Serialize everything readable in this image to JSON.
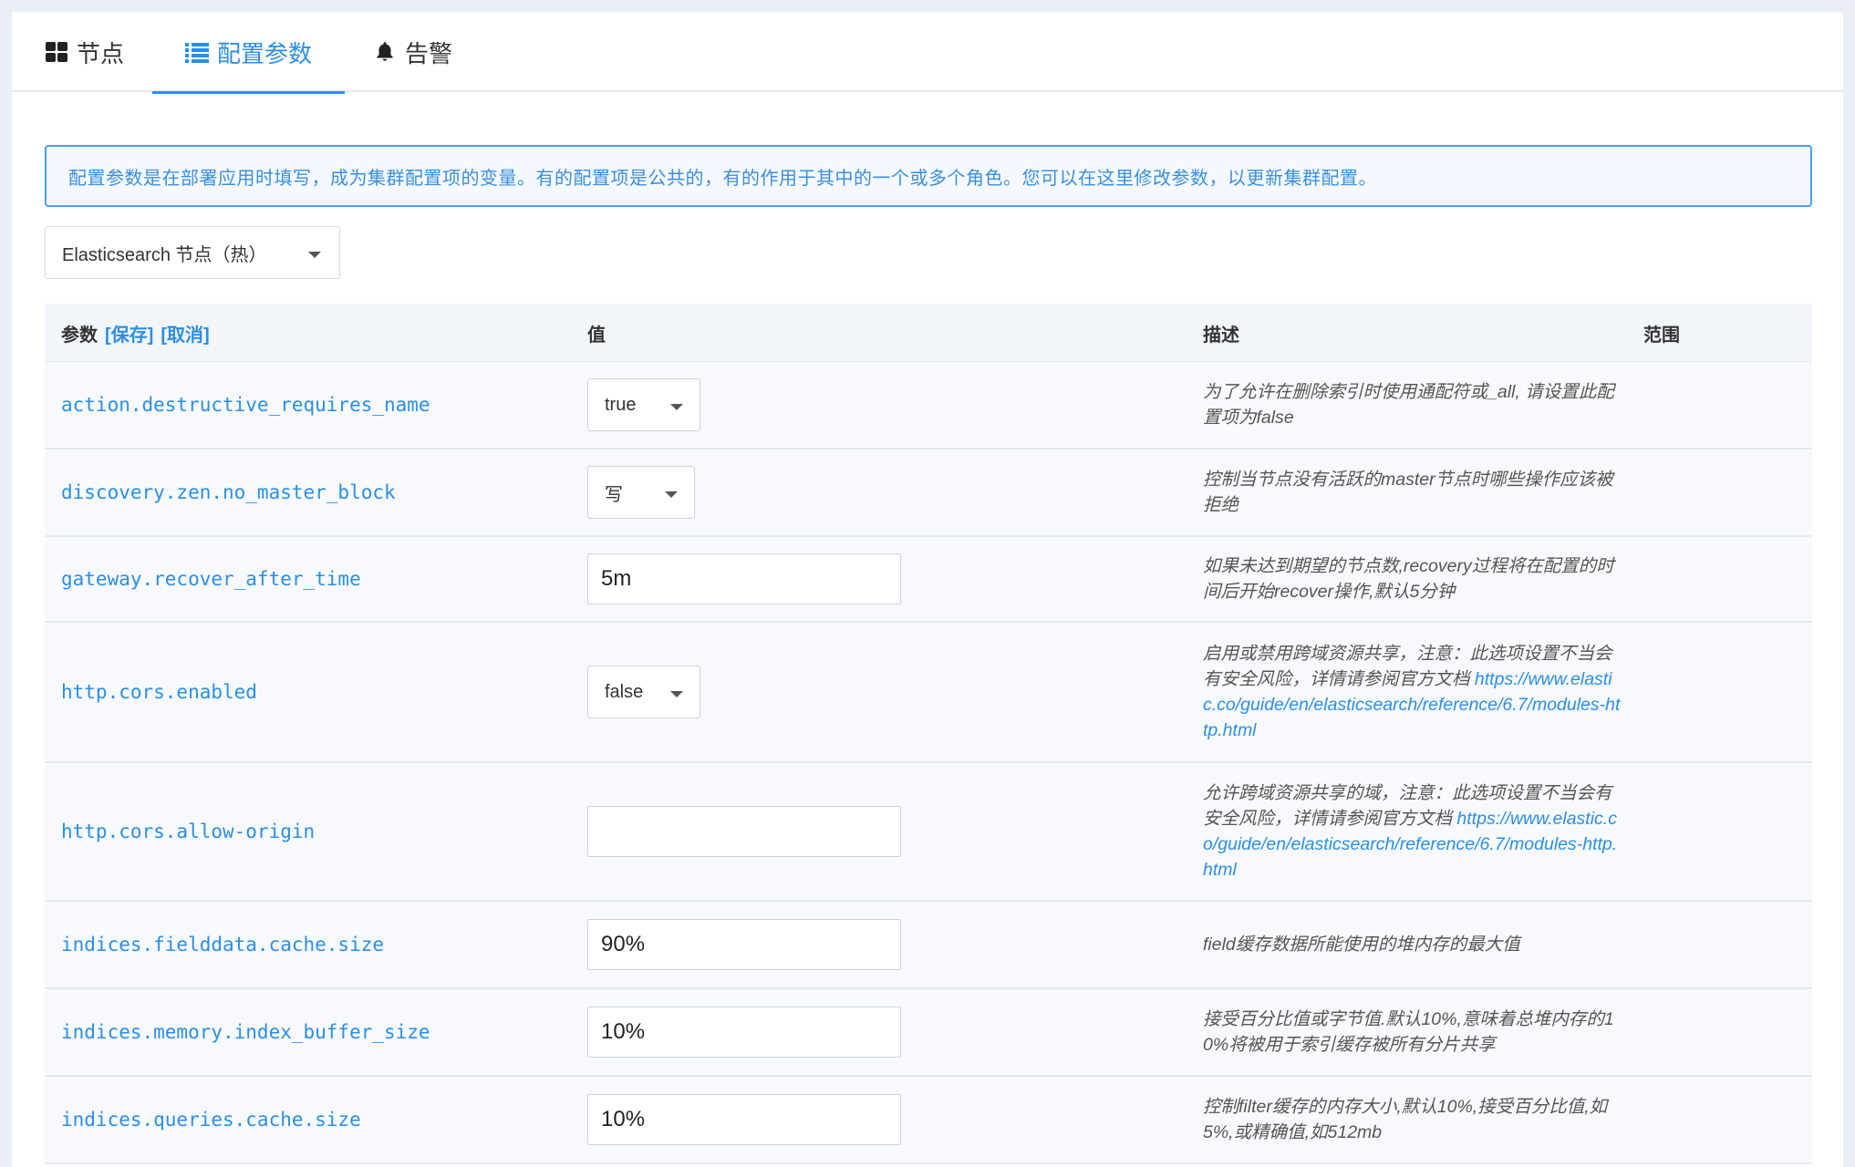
{
  "tabs": [
    {
      "label": "节点",
      "icon": "grid-icon",
      "active": false
    },
    {
      "label": "配置参数",
      "icon": "list-icon",
      "active": true
    },
    {
      "label": "告警",
      "icon": "bell-icon",
      "active": false
    }
  ],
  "info": "配置参数是在部署应用时填写，成为集群配置项的变量。有的配置项是公共的，有的作用于其中的一个或多个角色。您可以在这里修改参数，以更新集群配置。",
  "role_select": {
    "value": "Elasticsearch 节点（热）"
  },
  "table": {
    "headers": {
      "param": "参数",
      "save": "[保存]",
      "cancel": "[取消]",
      "value": "值",
      "desc": "描述",
      "range": "范围"
    },
    "rows": [
      {
        "name": "action.destructive_requires_name",
        "type": "select",
        "value": "true",
        "desc": "为了允许在删除索引时使用通配符或_all, 请设置此配置项为false",
        "link": ""
      },
      {
        "name": "discovery.zen.no_master_block",
        "type": "select",
        "value": "写",
        "desc": "控制当节点没有活跃的master节点时哪些操作应该被拒绝",
        "link": ""
      },
      {
        "name": "gateway.recover_after_time",
        "type": "text",
        "value": "5m",
        "desc": "如果未达到期望的节点数,recovery过程将在配置的时间后开始recover操作,默认5分钟",
        "link": ""
      },
      {
        "name": "http.cors.enabled",
        "type": "select",
        "value": "false",
        "desc": "启用或禁用跨域资源共享，注意：此选项设置不当会有安全风险，详情请参阅官方文档 ",
        "link": "https://www.elastic.co/guide/en/elasticsearch/reference/6.7/modules-http.html"
      },
      {
        "name": "http.cors.allow-origin",
        "type": "text",
        "value": "",
        "desc": "允许跨域资源共享的域，注意：此选项设置不当会有安全风险，详情请参阅官方文档 ",
        "link": "https://www.elastic.co/guide/en/elasticsearch/reference/6.7/modules-http.html"
      },
      {
        "name": "indices.fielddata.cache.size",
        "type": "text",
        "value": "90%",
        "desc": "field缓存数据所能使用的堆内存的最大值",
        "link": ""
      },
      {
        "name": "indices.memory.index_buffer_size",
        "type": "text",
        "value": "10%",
        "desc": "接受百分比值或字节值.默认10%,意味着总堆内存的10%将被用于索引缓存被所有分片共享",
        "link": ""
      },
      {
        "name": "indices.queries.cache.size",
        "type": "text",
        "value": "10%",
        "desc": "控制filter缓存的内存大小,默认10%,接受百分比值,如5%,或精确值,如512mb",
        "link": ""
      }
    ]
  },
  "colors": {
    "accent": "#2b8ee6",
    "row_bg": "#f7f9fc",
    "header_bg": "#f2f5fa"
  }
}
